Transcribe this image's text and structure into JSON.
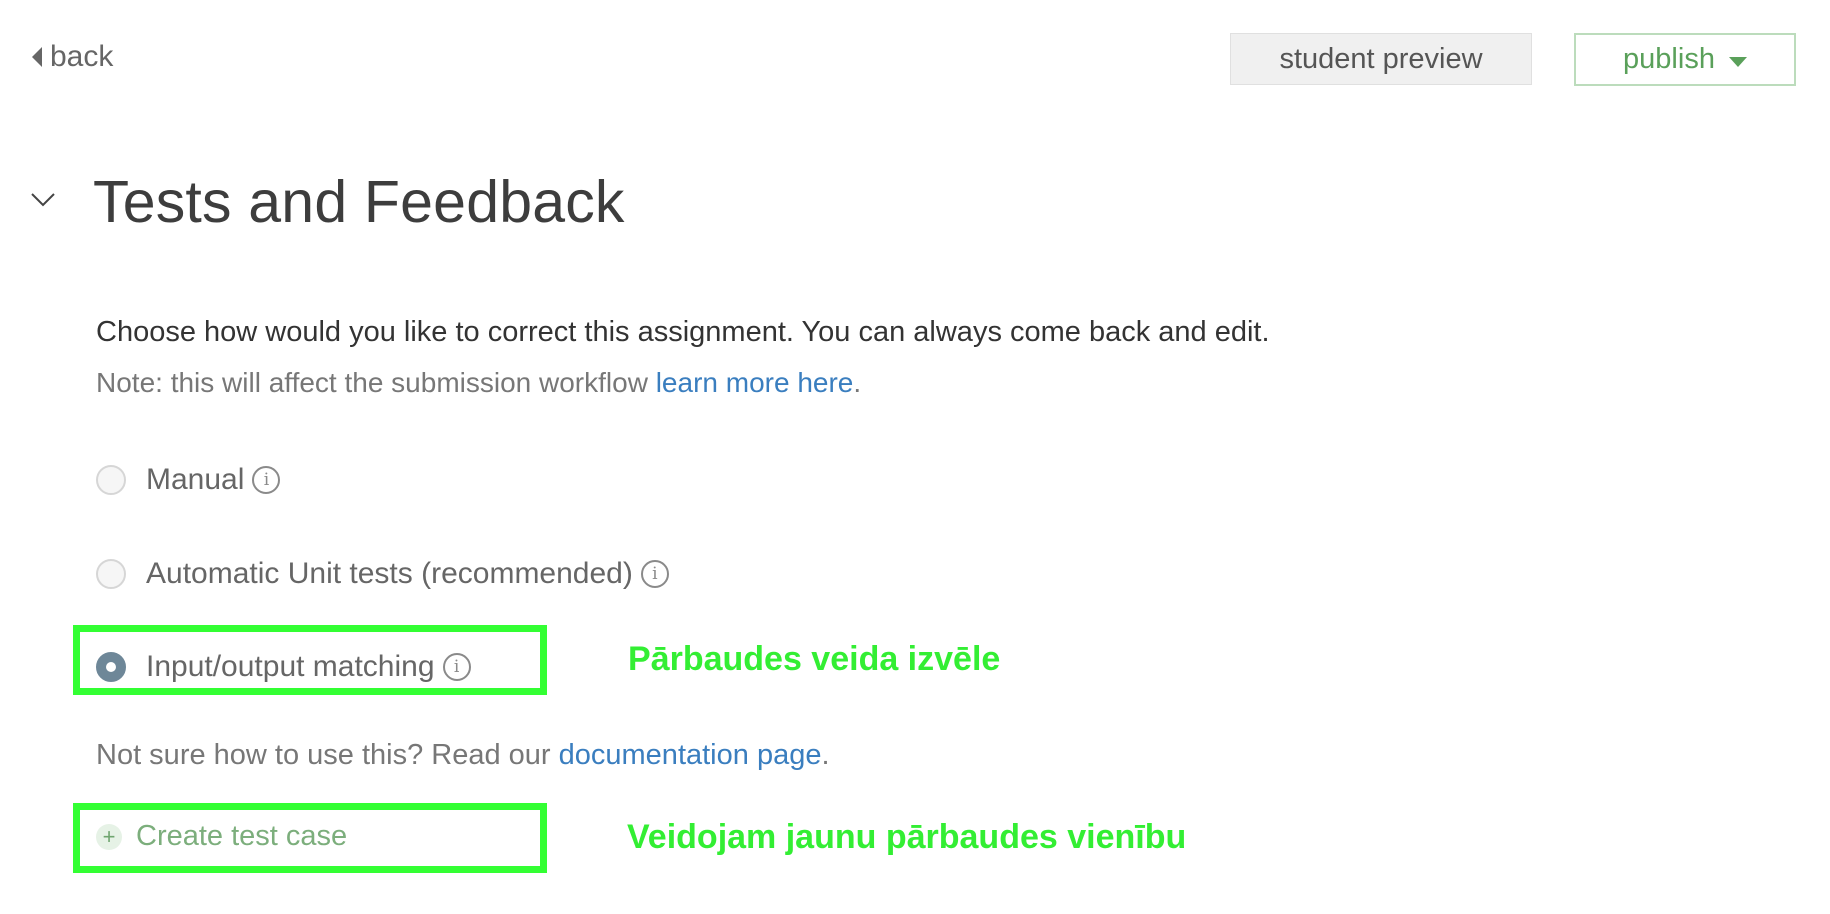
{
  "header": {
    "back_label": "back",
    "preview_label": "student preview",
    "publish_label": "publish"
  },
  "section": {
    "title": "Tests and Feedback",
    "intro": "Choose how would you like to correct this assignment. You can always come back and edit.",
    "note_text": "Note: this will affect the submission workflow ",
    "note_link": "learn more here",
    "note_end": "."
  },
  "options": [
    {
      "label": "Manual",
      "selected": false
    },
    {
      "label": "Automatic Unit tests (recommended)",
      "selected": false
    },
    {
      "label": "Input/output matching",
      "selected": true
    }
  ],
  "docs": {
    "text": "Not sure how to use this? Read our ",
    "link": "documentation page",
    "end": "."
  },
  "create": {
    "label": "Create test case"
  },
  "annotations": {
    "check_type": "Pārbaudes veida izvēle",
    "new_case": "Veidojam jaunu pārbaudes vienību",
    "color": "#33ff33"
  },
  "colors": {
    "link": "#3a7ebf",
    "publish": "#5aa05a",
    "radio_selected": "#6e8798"
  }
}
